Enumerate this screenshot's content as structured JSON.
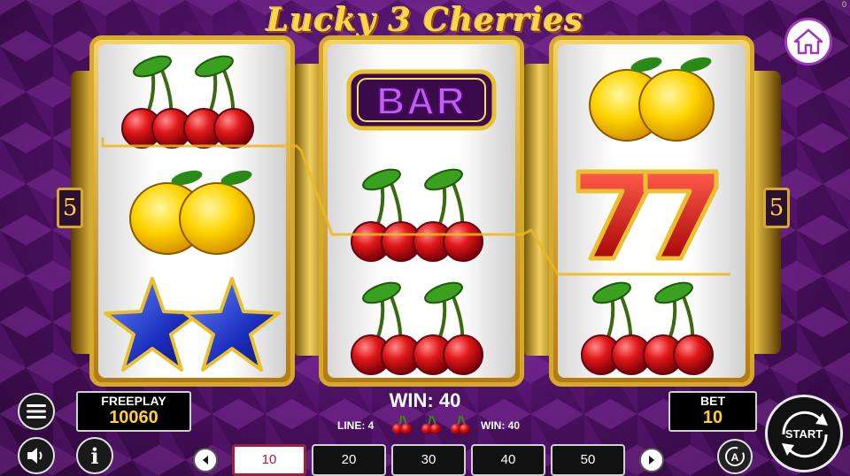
{
  "title": "Lucky 3 Cherries",
  "corner_value": "0",
  "icons": {
    "home": "home-icon",
    "menu": "menu-icon",
    "sound": "speaker-icon",
    "info": "info-icon",
    "autoplay": "autoplay-icon",
    "start": "start-spin-icon",
    "prev": "chevron-left-icon",
    "next": "chevron-right-icon"
  },
  "reels": [
    [
      "cherries",
      "lemons",
      "stars"
    ],
    [
      "bar",
      "cherries",
      "cherries"
    ],
    [
      "lemons",
      "sevens",
      "cherries"
    ]
  ],
  "bar_label": "BAR",
  "line_markers": {
    "left": "5",
    "right": "5"
  },
  "freeplay": {
    "label": "FREEPLAY",
    "value": "10060"
  },
  "bet": {
    "label": "BET",
    "value": "10"
  },
  "win": {
    "label": "WIN: 40",
    "line": "LINE: 4",
    "line_win": "WIN: 40"
  },
  "start_label": "START",
  "bet_options": [
    "10",
    "20",
    "30",
    "40",
    "50"
  ],
  "selected_bet": "10",
  "colors": {
    "gold": "#d7a92a",
    "purple": "#4a1060",
    "accent_red": "#a0203a"
  }
}
